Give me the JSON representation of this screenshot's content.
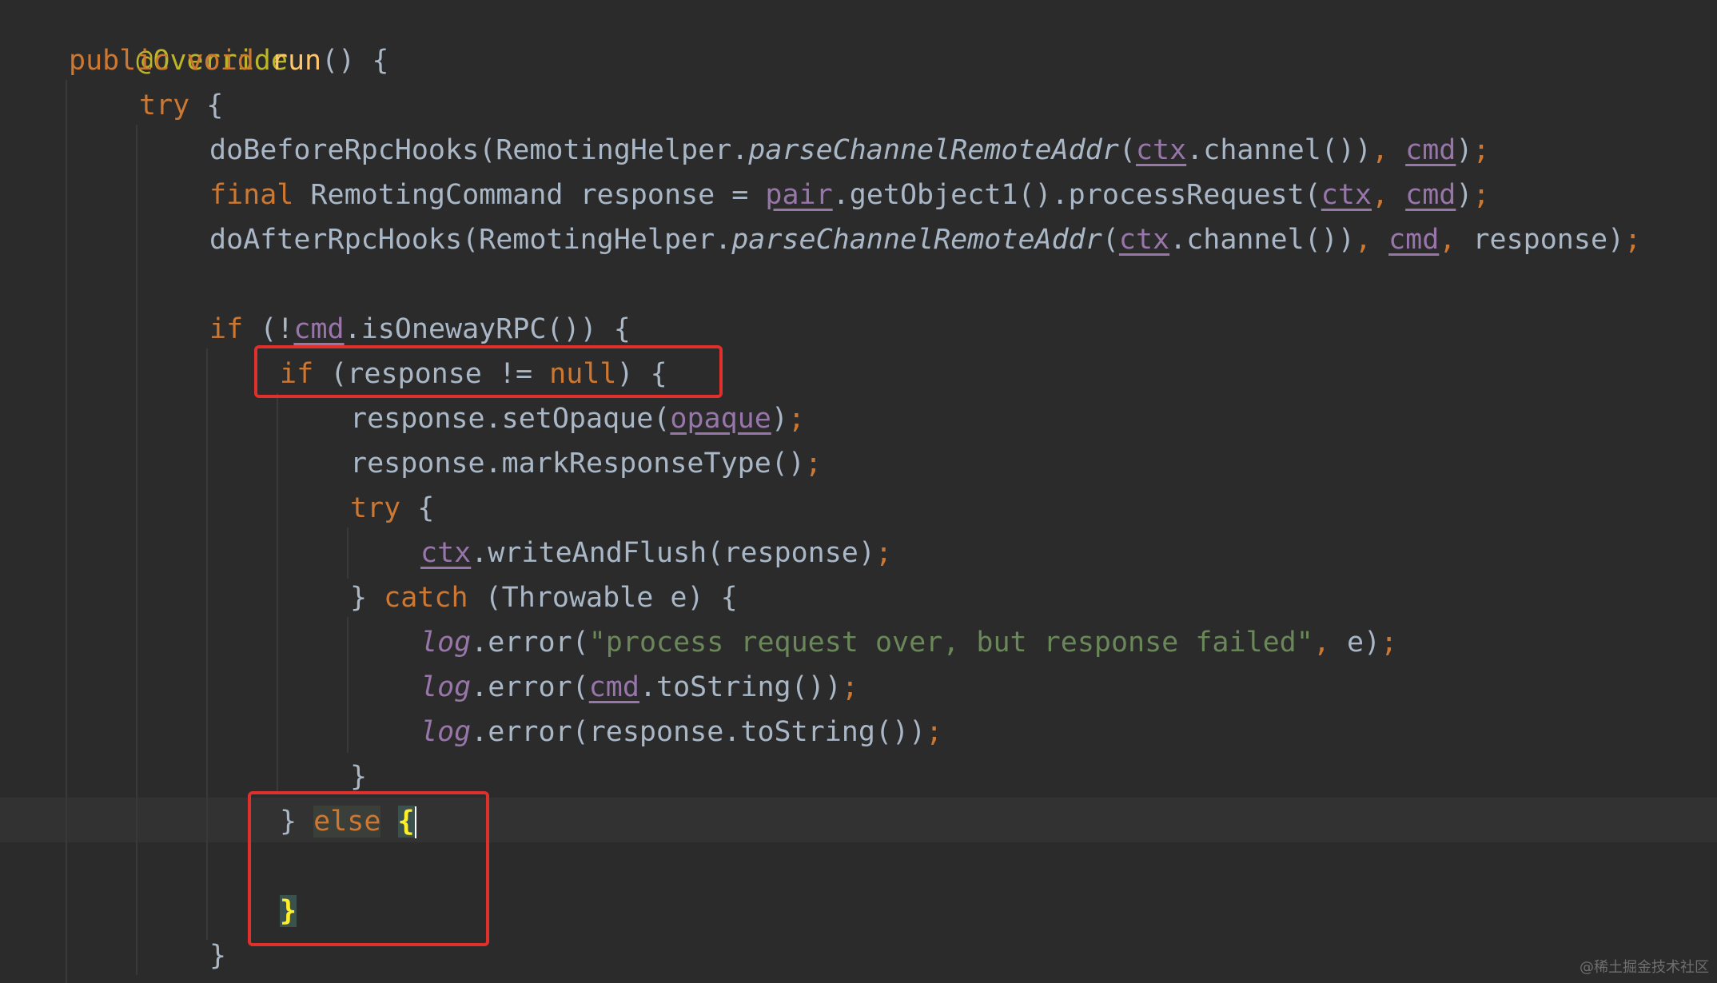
{
  "code": {
    "l1_annotation": "@Override",
    "l2_public": "public",
    "l2_void": "void",
    "l2_method": "run",
    "l2_rest": "() {",
    "l3_try": "try",
    "l3_brace": " {",
    "l4_a": "doBeforeRpcHooks(RemotingHelper.",
    "l4_static": "parseChannelRemoteAddr",
    "l4_b": "(",
    "l4_ctx": "ctx",
    "l4_c": ".channel())",
    "l4_comma": ", ",
    "l4_cmd": "cmd",
    "l4_d": ")",
    "l4_semi": ";",
    "l5_final": "final",
    "l5_a": " RemotingCommand response = ",
    "l5_pair": "pair",
    "l5_b": ".getObject1().processRequest(",
    "l5_ctx": "ctx",
    "l5_comma": ", ",
    "l5_cmd": "cmd",
    "l5_c": ")",
    "l5_semi": ";",
    "l6_a": "doAfterRpcHooks(RemotingHelper.",
    "l6_static": "parseChannelRemoteAddr",
    "l6_b": "(",
    "l6_ctx": "ctx",
    "l6_c": ".channel())",
    "l6_comma1": ", ",
    "l6_cmd": "cmd",
    "l6_comma2": ", ",
    "l6_d": "response)",
    "l6_semi": ";",
    "l8_if": "if",
    "l8_a": " (!",
    "l8_cmd": "cmd",
    "l8_b": ".isOnewayRPC()) {",
    "l9_if": "if",
    "l9_a": " (response != ",
    "l9_null": "null",
    "l9_b": ") {",
    "l10_a": "response.setOpaque(",
    "l10_opaque": "opaque",
    "l10_b": ")",
    "l10_semi": ";",
    "l11_a": "response.markResponseType()",
    "l11_semi": ";",
    "l12_try": "try",
    "l12_brace": " {",
    "l13_ctx": "ctx",
    "l13_a": ".writeAndFlush(response)",
    "l13_semi": ";",
    "l14_a": "} ",
    "l14_catch": "catch",
    "l14_b": " (Throwable e) {",
    "l15_log": "log",
    "l15_a": ".error(",
    "l15_str": "\"process request over, but response failed\"",
    "l15_comma": ", ",
    "l15_b": "e)",
    "l15_semi": ";",
    "l16_log": "log",
    "l16_a": ".error(",
    "l16_cmd": "cmd",
    "l16_b": ".toString())",
    "l16_semi": ";",
    "l17_log": "log",
    "l17_a": ".error(response.toString())",
    "l17_semi": ";",
    "l18_brace": "}",
    "l19_a": "} ",
    "l19_else": "else",
    "l19_brace": "{",
    "l21_brace": "}",
    "l22_brace": "}"
  },
  "watermark": "@稀土掘金技术社区"
}
